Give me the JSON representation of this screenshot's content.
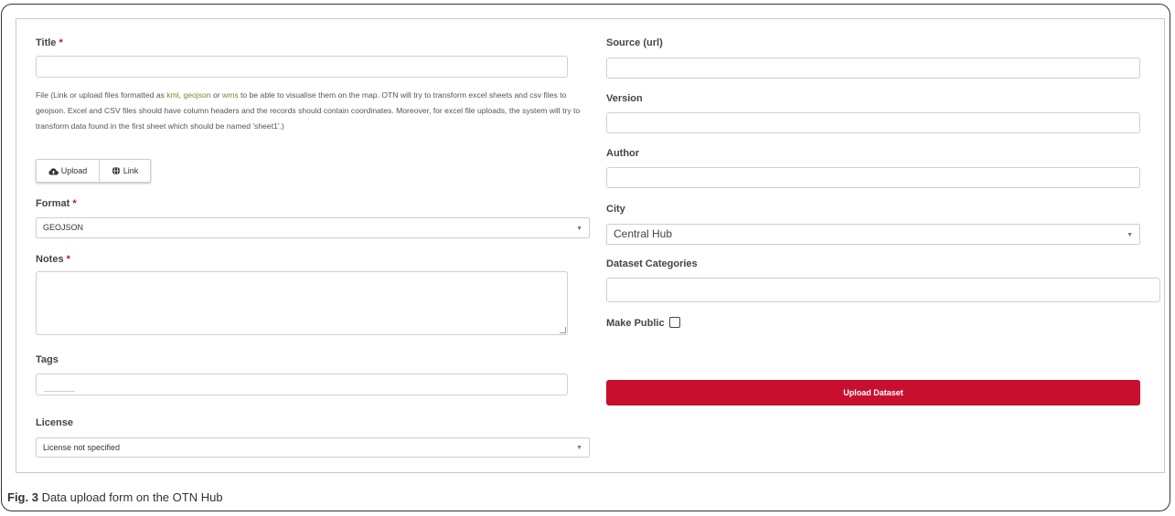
{
  "form": {
    "title_label": "Title",
    "required_mark": "*",
    "title_value": "",
    "file_help": {
      "part1": "File (Link or upload files formatted as ",
      "kml": "kml",
      "sep1": ", ",
      "geojson": "geojson",
      "sep2": " or ",
      "wms": "wms",
      "part2": " to be able to visualise them on the map. OTN will try to transform excel sheets and csv files to geojson. Excel and CSV files should have column headers and the records should contain coordinates. Moreover, for excel file uploads, the system will try to transform data found in the first sheet which should be named 'sheet1'.)"
    },
    "upload_label": "Upload",
    "link_label": "Link",
    "format_label": "Format",
    "format_value": "GEOJSON",
    "notes_label": "Notes",
    "notes_value": "",
    "tags_label": "Tags",
    "license_label": "License",
    "license_value": "License not specified",
    "source_label": "Source (url)",
    "source_value": "",
    "version_label": "Version",
    "version_value": "",
    "author_label": "Author",
    "author_value": "",
    "city_label": "City",
    "city_value": "Central Hub",
    "categories_label": "Dataset Categories",
    "categories_value": "",
    "make_public_label": "Make Public",
    "make_public_checked": false,
    "submit_label": "Upload Dataset"
  },
  "caption": {
    "fig": "Fig. 3",
    "text": " Data upload form on the OTN Hub"
  },
  "icons": {
    "upload": "cloud-upload-icon",
    "link": "globe-icon",
    "dropdown": "caret-down-icon"
  },
  "colors": {
    "accent": "#c8102e",
    "link": "#7a8a2a"
  }
}
